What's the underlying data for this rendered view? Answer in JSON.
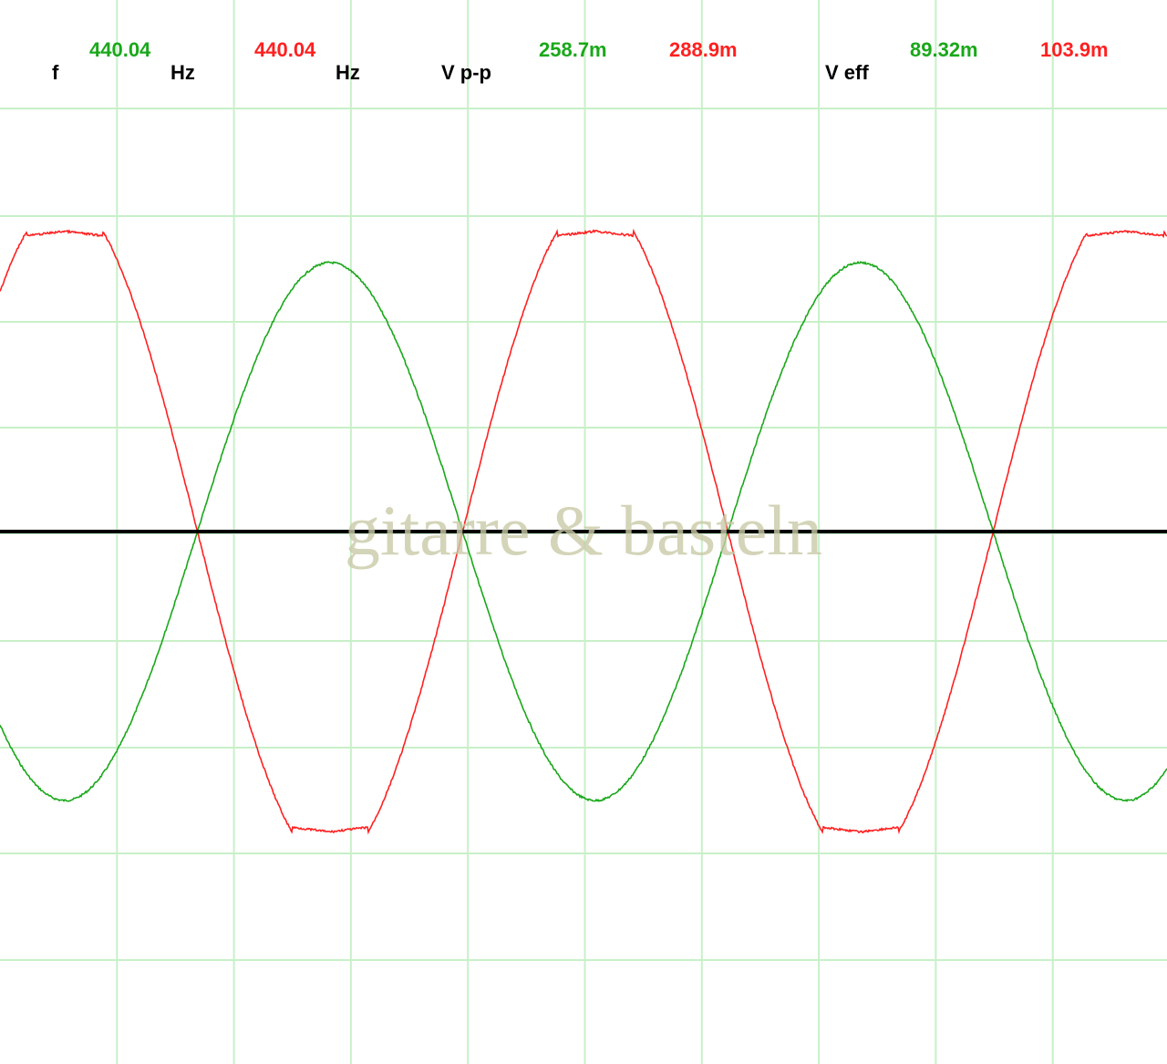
{
  "readout": {
    "freq_label": "f",
    "freq_ch1": "440.04",
    "freq_unit_1": "Hz",
    "freq_ch2": "440.04",
    "freq_unit_2": "Hz",
    "vpp_label": "V p-p",
    "vpp_ch1": "258.7m",
    "vpp_ch2": "288.9m",
    "veff_label": "V eff",
    "veff_ch1": "89.32m",
    "veff_ch2": "103.9m"
  },
  "watermark": "gitarre & basteln",
  "colors": {
    "background": "#ffffff",
    "grid": "#c8f0c8",
    "baseline": "#000000",
    "channel_1": "#1aa81a",
    "channel_2": "#ff2020",
    "label": "#000000",
    "watermark": "#c9c9a8"
  },
  "chart_data": {
    "type": "line",
    "grid": true,
    "x_divisions": 10,
    "y_divisions": 10,
    "zero_line": true,
    "cycles_shown": 2.2,
    "series": [
      {
        "name": "",
        "color": "#1aa81a",
        "shape": "sine",
        "frequency": 440.04,
        "vpp": 258.7,
        "veff": 89.32,
        "phase_deg": 226
      },
      {
        "name": "",
        "color": "#ff2020",
        "shape": "clipped-sine",
        "frequency": 440.04,
        "vpp": 288.9,
        "veff": 103.9,
        "phase_deg": 46,
        "clip_fraction": 0.9
      }
    ]
  }
}
